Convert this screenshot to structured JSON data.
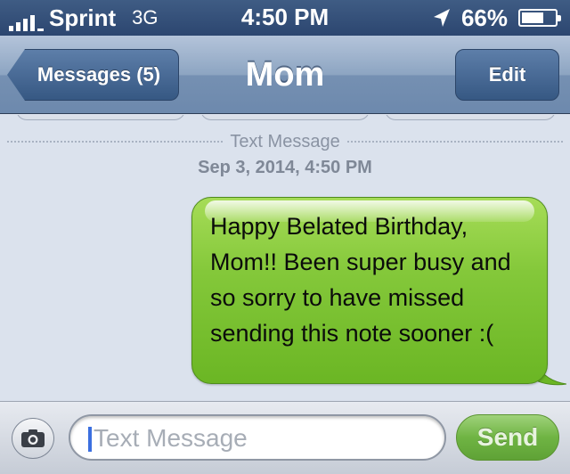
{
  "status_bar": {
    "carrier": "Sprint",
    "network": "3G",
    "time": "4:50 PM",
    "battery_percent": "66%",
    "battery_level": 0.66,
    "icons": [
      "signal-bars-icon",
      "location-arrow-icon",
      "battery-icon"
    ]
  },
  "nav": {
    "back_label": "Messages (5)",
    "title": "Mom",
    "edit_label": "Edit"
  },
  "conversation": {
    "divider_label": "Text Message",
    "timestamp": "Sep 3, 2014, 4:50 PM",
    "messages": [
      {
        "direction": "outgoing",
        "text": "Happy Belated Birthday, Mom!! Been super busy and so sorry to have missed sending this note sooner :("
      }
    ]
  },
  "composer": {
    "placeholder": "Text Message",
    "value": "",
    "send_label": "Send",
    "camera_icon": "camera-icon"
  },
  "colors": {
    "bubble_green": "#84c83a",
    "nav_blue": "#6d89ad",
    "background": "#dbe2ed"
  }
}
